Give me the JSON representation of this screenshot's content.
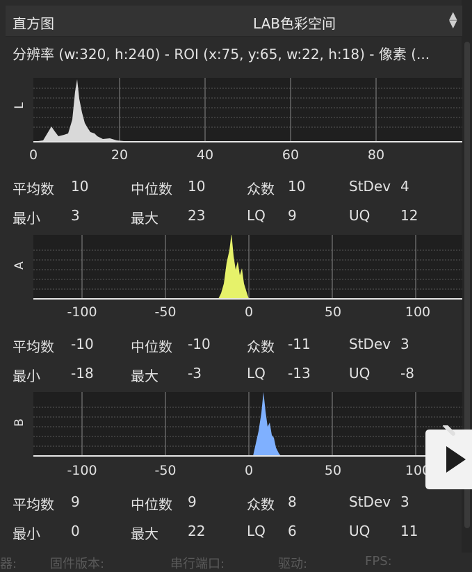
{
  "header": {
    "title": "直方图",
    "color_space": "LAB色彩空间",
    "updown_icon": "updown-arrows-icon"
  },
  "info": "分辨率 (w:320, h:240) - ROI (x:75, y:65, w:22, h:18) - 像素 (...",
  "channels": [
    {
      "axis_label": "L",
      "ticks": [
        "0",
        "20",
        "40",
        "60",
        "80"
      ],
      "stats_row1": [
        {
          "label": "平均数",
          "value": "10"
        },
        {
          "label": "中位数",
          "value": "10"
        },
        {
          "label": "众数",
          "value": "10"
        },
        {
          "label": "StDev",
          "value": "4"
        }
      ],
      "stats_row2": [
        {
          "label": "最小",
          "value": "3"
        },
        {
          "label": "最大",
          "value": "23"
        },
        {
          "label": "LQ",
          "value": "9"
        },
        {
          "label": "UQ",
          "value": "12"
        }
      ],
      "color": "#d9d9d9"
    },
    {
      "axis_label": "A",
      "ticks": [
        "-100",
        "-50",
        "0",
        "50",
        "100"
      ],
      "stats_row1": [
        {
          "label": "平均数",
          "value": "-10"
        },
        {
          "label": "中位数",
          "value": "-10"
        },
        {
          "label": "众数",
          "value": "-11"
        },
        {
          "label": "StDev",
          "value": "3"
        }
      ],
      "stats_row2": [
        {
          "label": "最小",
          "value": "-18"
        },
        {
          "label": "最大",
          "value": "-3"
        },
        {
          "label": "LQ",
          "value": "-13"
        },
        {
          "label": "UQ",
          "value": "-8"
        }
      ],
      "color": "#e6f26a"
    },
    {
      "axis_label": "B",
      "ticks": [
        "-100",
        "-50",
        "0",
        "50",
        "100"
      ],
      "stats_row1": [
        {
          "label": "平均数",
          "value": "9"
        },
        {
          "label": "中位数",
          "value": "9"
        },
        {
          "label": "众数",
          "value": "8"
        },
        {
          "label": "StDev",
          "value": "3"
        }
      ],
      "stats_row2": [
        {
          "label": "最小",
          "value": "0"
        },
        {
          "label": "最大",
          "value": "22"
        },
        {
          "label": "LQ",
          "value": "6"
        },
        {
          "label": "UQ",
          "value": "11"
        }
      ],
      "color": "#7fb0ff"
    }
  ],
  "footer": [
    "器:",
    "固件版本:",
    "串行端口:",
    "驱动:",
    "FPS:"
  ]
}
